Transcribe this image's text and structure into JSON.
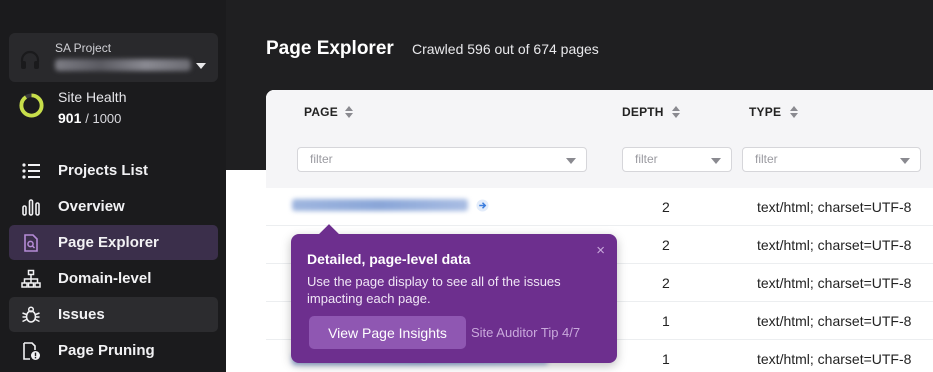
{
  "sidebar": {
    "project": {
      "label": "SA Project",
      "selector_value": ""
    },
    "site_health": {
      "label": "Site Health",
      "score": "901",
      "max": "/ 1000",
      "fraction": 0.901,
      "ring_color": "#c7de4a"
    },
    "nav": [
      {
        "label": "Projects List",
        "icon": "list-icon"
      },
      {
        "label": "Overview",
        "icon": "bar-chart-icon"
      },
      {
        "label": "Page Explorer",
        "icon": "page-search-icon",
        "active": true
      },
      {
        "label": "Domain-level",
        "icon": "sitemap-icon"
      },
      {
        "label": "Issues",
        "icon": "bug-icon"
      },
      {
        "label": "Page Pruning",
        "icon": "page-alert-icon"
      }
    ]
  },
  "header": {
    "title": "Page Explorer",
    "subtitle": "Crawled 596 out of 674 pages"
  },
  "table": {
    "columns": [
      {
        "label": "PAGE",
        "filter_placeholder": "filter"
      },
      {
        "label": "DEPTH",
        "filter_placeholder": "filter"
      },
      {
        "label": "TYPE",
        "filter_placeholder": "filter"
      }
    ],
    "rows": [
      {
        "depth": "2",
        "type": "text/html; charset=UTF-8"
      },
      {
        "depth": "2",
        "type": "text/html; charset=UTF-8"
      },
      {
        "depth": "2",
        "type": "text/html; charset=UTF-8"
      },
      {
        "depth": "1",
        "type": "text/html; charset=UTF-8"
      },
      {
        "depth": "1",
        "type": "text/html; charset=UTF-8"
      }
    ]
  },
  "tooltip": {
    "title": "Detailed, page-level data",
    "body": "Use the page display to see all of the issues impacting each page.",
    "button": "View Page Insights",
    "step": "Site Auditor Tip 4/7",
    "close": "×"
  },
  "colors": {
    "accent_purple": "#6d2f8e",
    "health_green": "#c7de4a",
    "link_blue": "#3b7ddd"
  }
}
